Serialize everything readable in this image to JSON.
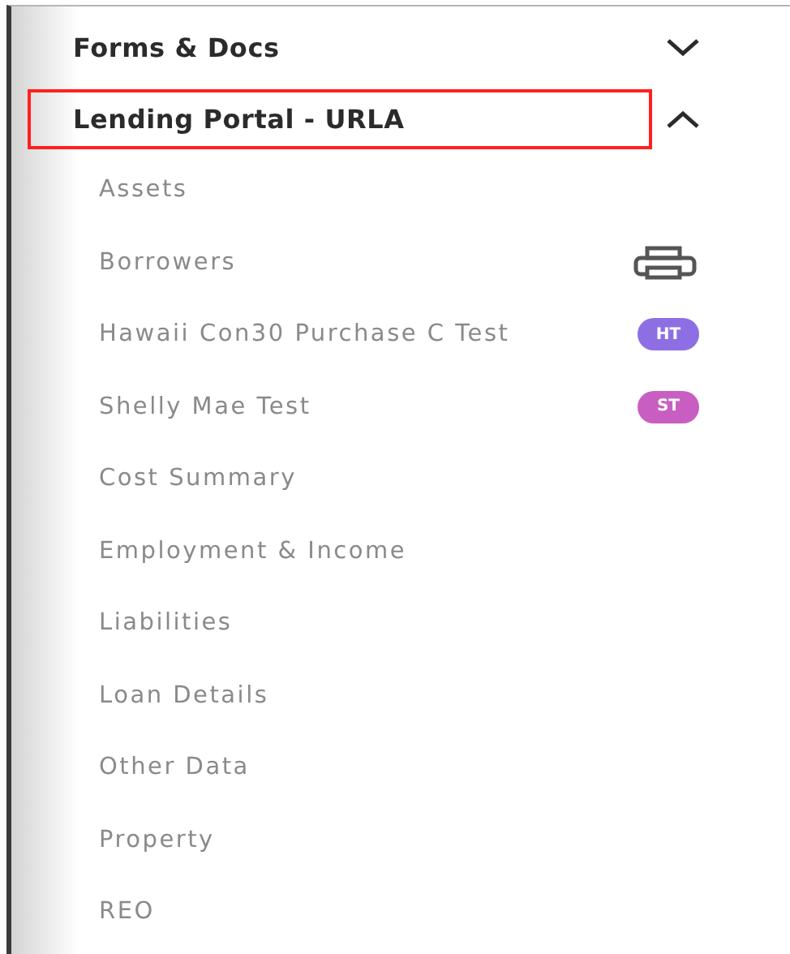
{
  "sections": [
    {
      "title": "Forms & Docs",
      "expanded": false,
      "highlighted": false
    },
    {
      "title": "Lending Portal - URLA",
      "expanded": true,
      "highlighted": true,
      "items": [
        {
          "label": "Assets",
          "kind": "plain"
        },
        {
          "label": "Borrowers",
          "kind": "print"
        },
        {
          "label": "Hawaii Con30 Purchase C Test",
          "kind": "badge",
          "badge": "HT",
          "color": "#8e6fe3"
        },
        {
          "label": "Shelly Mae Test",
          "kind": "badge",
          "badge": "ST",
          "color": "#c85ec2"
        },
        {
          "label": "Cost Summary",
          "kind": "plain"
        },
        {
          "label": "Employment & Income",
          "kind": "plain"
        },
        {
          "label": "Liabilities",
          "kind": "plain"
        },
        {
          "label": "Loan Details",
          "kind": "plain"
        },
        {
          "label": "Other Data",
          "kind": "plain"
        },
        {
          "label": "Property",
          "kind": "plain"
        },
        {
          "label": "REO",
          "kind": "plain"
        }
      ]
    }
  ]
}
